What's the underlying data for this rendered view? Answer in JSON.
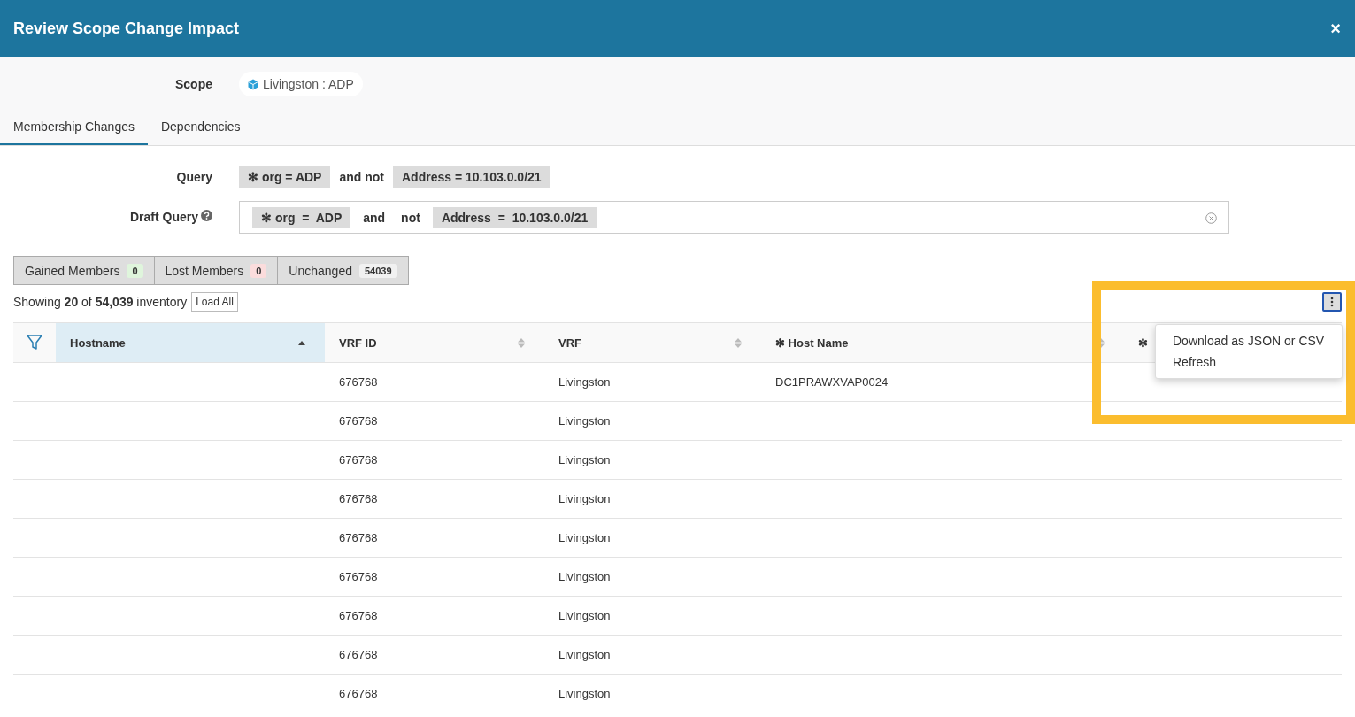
{
  "window": {
    "title": "Review Scope Change Impact",
    "close": "×"
  },
  "scope": {
    "label": "Scope",
    "value": "Livingston : ADP"
  },
  "tabs": [
    {
      "label": "Membership Changes",
      "selected": true
    },
    {
      "label": "Dependencies",
      "selected": false
    }
  ],
  "query": {
    "label": "Query",
    "parts": [
      {
        "kind": "chip",
        "text": "✻ org = ADP"
      },
      {
        "kind": "word",
        "text": "and not"
      },
      {
        "kind": "chip",
        "text": "Address = 10.103.0.0/21"
      }
    ]
  },
  "draft_query": {
    "label": "Draft Query",
    "parts": [
      {
        "kind": "chip",
        "text": "✻ org  =  ADP"
      },
      {
        "kind": "word",
        "text": "and"
      },
      {
        "kind": "word",
        "text": "not"
      },
      {
        "kind": "chip",
        "text": "Address  =  10.103.0.0/21"
      }
    ]
  },
  "member_tabs": [
    {
      "label": "Gained Members",
      "count": "0",
      "color": "#dff5dc"
    },
    {
      "label": "Lost Members",
      "count": "0",
      "color": "#fbdcdc"
    },
    {
      "label": "Unchanged",
      "count": "54039",
      "color": "#f1f1f1"
    }
  ],
  "summary": {
    "text": "Showing **20** of **54,039** inventory",
    "button": "Load All"
  },
  "table": {
    "columns": [
      {
        "label": "Hostname",
        "sorted": true
      },
      {
        "label": "VRF ID",
        "sorted": false
      },
      {
        "label": "VRF",
        "sorted": false
      },
      {
        "label": "✻ Host Name",
        "sorted": false
      },
      {
        "label": "✻"
      }
    ],
    "rows": [
      [
        "",
        "676768",
        "Livingston",
        "DC1PRAWXVAP0024"
      ],
      [
        "",
        "676768",
        "Livingston",
        ""
      ],
      [
        "",
        "676768",
        "Livingston",
        ""
      ],
      [
        "",
        "676768",
        "Livingston",
        ""
      ],
      [
        "",
        "676768",
        "Livingston",
        ""
      ],
      [
        "",
        "676768",
        "Livingston",
        ""
      ],
      [
        "",
        "676768",
        "Livingston",
        ""
      ],
      [
        "",
        "676768",
        "Livingston",
        ""
      ],
      [
        "",
        "676768",
        "Livingston",
        ""
      ]
    ]
  },
  "menu": {
    "expanded": true,
    "items": [
      "Download as JSON or CSV",
      "Refresh"
    ]
  }
}
